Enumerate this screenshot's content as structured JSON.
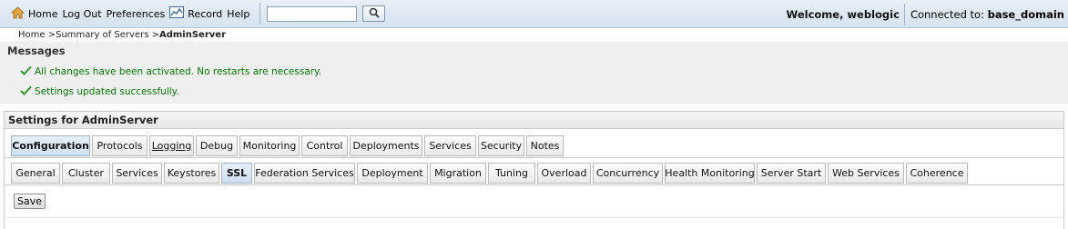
{
  "topbar": {
    "home_label": "Home",
    "logout_label": "Log Out",
    "preferences_label": "Preferences",
    "record_label": "Record",
    "help_label": "Help",
    "search_value": "",
    "welcome_text": "Welcome, weblogic",
    "connected_prefix": "Connected to: ",
    "connected_domain": "base_domain",
    "icons": {
      "home": "home-icon",
      "record": "record-icon",
      "search": "search-icon"
    }
  },
  "breadcrumb": {
    "home": "Home",
    "sep1": " >",
    "summary": "Summary of Servers",
    "sep2": " >",
    "current": "AdminServer"
  },
  "messages": {
    "title": "Messages",
    "items": [
      "All changes have been activated. No restarts are necessary.",
      "Settings updated successfully."
    ],
    "success_color": "#007a00"
  },
  "settings": {
    "title": "Settings for AdminServer",
    "tabs": [
      "Configuration",
      "Protocols",
      "Logging",
      "Debug",
      "Monitoring",
      "Control",
      "Deployments",
      "Services",
      "Security",
      "Notes"
    ],
    "active_tab": "Configuration",
    "subtabs": [
      "General",
      "Cluster",
      "Services",
      "Keystores",
      "SSL",
      "Federation Services",
      "Deployment",
      "Migration",
      "Tuning",
      "Overload",
      "Concurrency",
      "Health Monitoring",
      "Server Start",
      "Web Services",
      "Coherence"
    ],
    "active_subtab": "SSL",
    "save_label": "Save"
  }
}
